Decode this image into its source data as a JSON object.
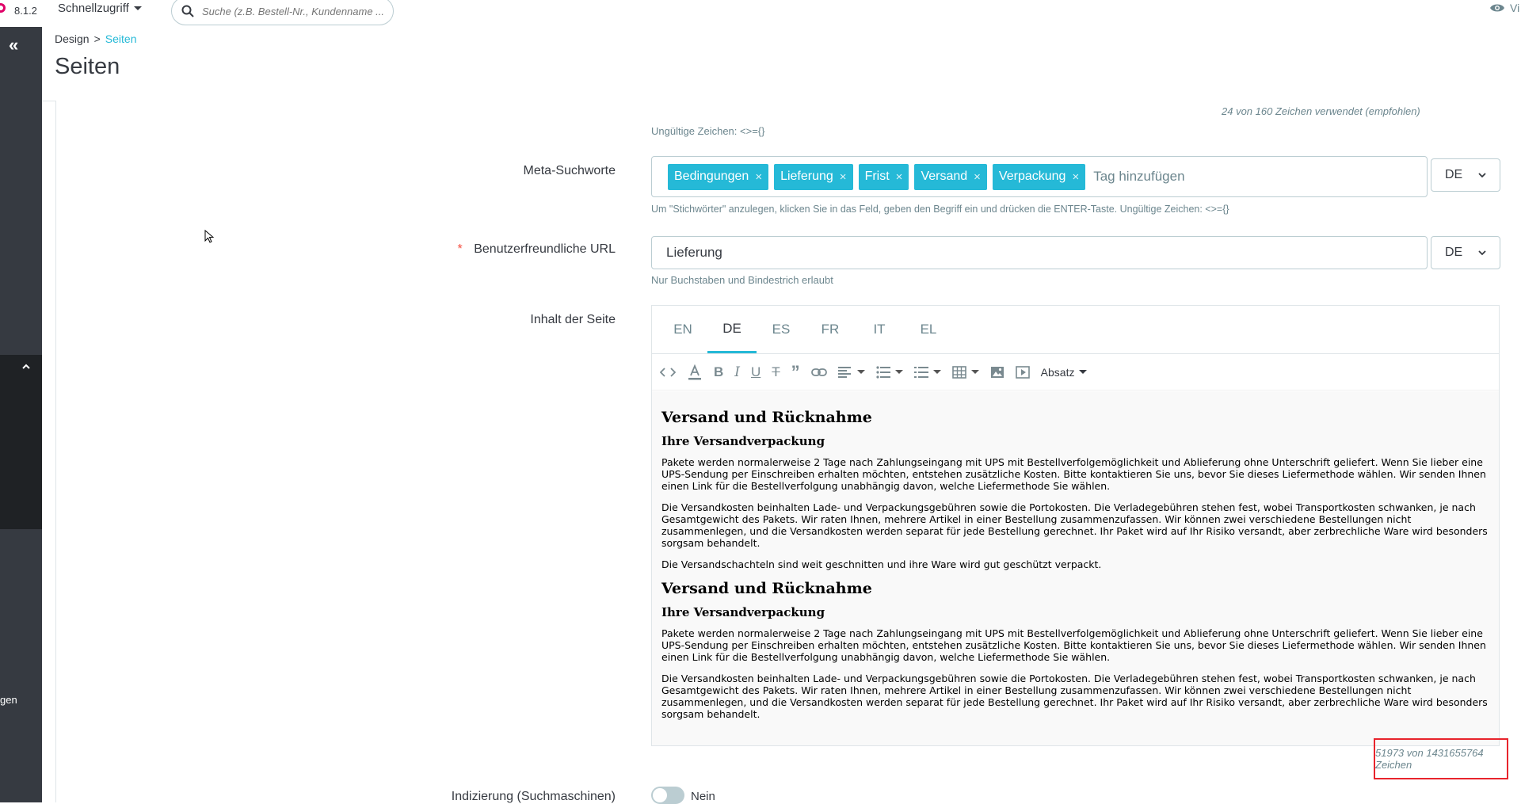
{
  "header": {
    "version": "8.1.2",
    "quick_access": "Schnellzugriff",
    "search_placeholder": "Suche (z.B. Bestell-Nr., Kundenname ...",
    "view_label": "Vi"
  },
  "sidebar": {
    "bottom_label": "gen"
  },
  "breadcrumb": {
    "parent": "Design",
    "separator": ">",
    "current": "Seiten"
  },
  "page_title": "Seiten",
  "meta_title_counter": "24 von 160 Zeichen verwendet (empfohlen)",
  "invalid_chars_hint": "Ungültige Zeichen: <>={}",
  "meta_keywords": {
    "label": "Meta-Suchworte",
    "tags": [
      "Bedingungen",
      "Lieferung",
      "Frist",
      "Versand",
      "Verpackung"
    ],
    "input_placeholder": "Tag hinzufügen",
    "lang": "DE",
    "help": "Um \"Stichwörter\" anzulegen, klicken Sie in das Feld, geben den Begriff ein und drücken die ENTER-Taste. Ungültige Zeichen: <>={}"
  },
  "friendly_url": {
    "required_mark": "*",
    "label": "Benutzerfreundliche URL",
    "value": "Lieferung",
    "lang": "DE",
    "help": "Nur Buchstaben und Bindestrich erlaubt"
  },
  "content": {
    "label": "Inhalt der Seite",
    "tabs": [
      "EN",
      "DE",
      "ES",
      "FR",
      "IT",
      "EL"
    ],
    "active_tab": "DE",
    "paragraph_format": "Absatz",
    "body": {
      "h2_1": "Versand und Rücknahme",
      "h3_1": "Ihre Versandverpackung",
      "p1": "Pakete werden normalerweise 2 Tage nach Zahlungseingang mit UPS mit Bestellverfolgemöglichkeit und Ablieferung ohne Unterschrift geliefert. Wenn Sie lieber eine UPS-Sendung per Einschreiben erhalten möchten, entstehen zusätzliche Kosten. Bitte kontaktieren Sie uns, bevor Sie dieses Liefermethode wählen. Wir senden Ihnen einen Link für die Bestellverfolgung unabhängig davon, welche Liefermethode Sie wählen.",
      "p2": "Die Versandkosten beinhalten Lade- und Verpackungsgebühren sowie die Portokosten. Die Verladegebühren stehen fest, wobei Transportkosten schwanken, je nach Gesamtgewicht des Pakets. Wir raten Ihnen, mehrere Artikel in einer Bestellung zusammenzufassen. Wir können zwei verschiedene Bestellungen nicht zusammenlegen, und die Versandkosten werden separat für jede Bestellung gerechnet. Ihr Paket wird auf Ihr Risiko versandt, aber zerbrechliche Ware wird besonders sorgsam behandelt.",
      "p3": "Die Versandschachteln sind weit geschnitten und ihre Ware wird gut geschützt verpackt.",
      "h2_2": "Versand und Rücknahme",
      "h3_2": "Ihre Versandverpackung",
      "p4": "Pakete werden normalerweise 2 Tage nach Zahlungseingang mit UPS mit Bestellverfolgemöglichkeit und Ablieferung ohne Unterschrift geliefert. Wenn Sie lieber eine UPS-Sendung per Einschreiben erhalten möchten, entstehen zusätzliche Kosten. Bitte kontaktieren Sie uns, bevor Sie dieses Liefermethode wählen. Wir senden Ihnen einen Link für die Bestellverfolgung unabhängig davon, welche Liefermethode Sie wählen.",
      "p5": "Die Versandkosten beinhalten Lade- und Verpackungsgebühren sowie die Portokosten. Die Verladegebühren stehen fest, wobei Transportkosten schwanken, je nach Gesamtgewicht des Pakets. Wir raten Ihnen, mehrere Artikel in einer Bestellung zusammenzufassen. Wir können zwei verschiedene Bestellungen nicht zusammenlegen, und die Versandkosten werden separat für jede Bestellung gerechnet. Ihr Paket wird auf Ihr Risiko versandt, aber zerbrechliche Ware wird besonders sorgsam behandelt."
    },
    "char_count": "51973 von 1431655764 Zeichen"
  },
  "indexing": {
    "label": "Indizierung (Suchmaschinen)",
    "value": "Nein"
  },
  "colors": {
    "accent": "#25b9d7",
    "sidebar": "#363a41",
    "highlight_border": "#e8242c"
  }
}
